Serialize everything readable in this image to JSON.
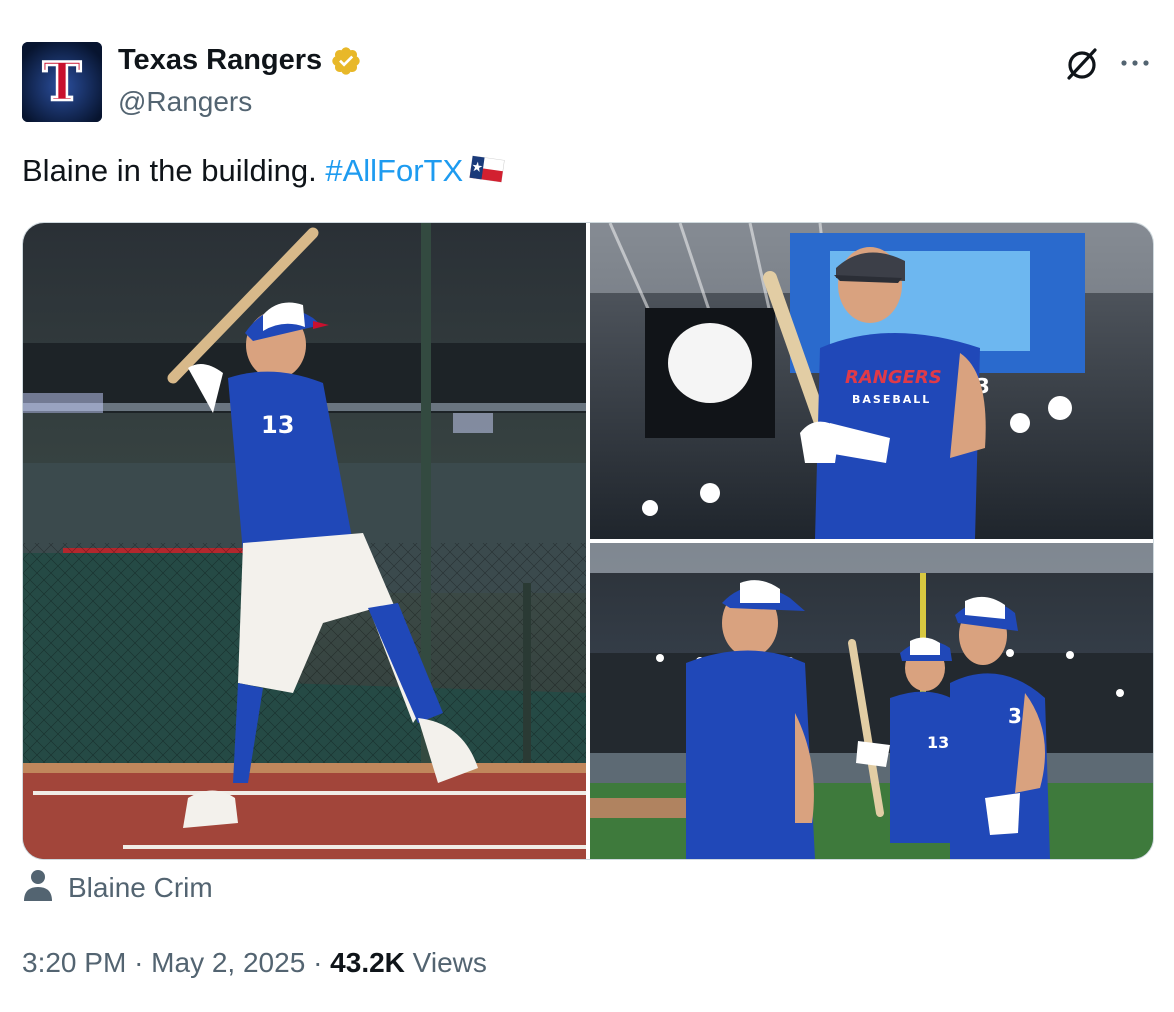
{
  "author": {
    "name": "Texas Rangers",
    "handle": "@Rangers",
    "verified": true,
    "avatar_letter": "T"
  },
  "tweet": {
    "text": "Blaine in the building.",
    "hashtag": "#AllForTX",
    "emoji": "texas-flag-emoji"
  },
  "tagged_user": {
    "name": "Blaine Crim",
    "icon": "person-icon"
  },
  "meta": {
    "time": "3:20 PM",
    "sep1": "·",
    "date": "May 2, 2025",
    "sep2": "·",
    "views_count": "43.2K",
    "views_label": "Views"
  },
  "colors": {
    "link": "#1d9bf0",
    "secondary_text": "#536471",
    "primary_text": "#0f1419",
    "verified_gold": "#e8b829",
    "jersey_blue": "#1f4fc1"
  },
  "photos": [
    {
      "jersey_number": "13"
    },
    {
      "chest_text_1": "RANGERS",
      "chest_text_2": "BASEBALL",
      "sleeve_number": "13"
    },
    {
      "player1_number": "13",
      "player2_number": "36"
    }
  ]
}
